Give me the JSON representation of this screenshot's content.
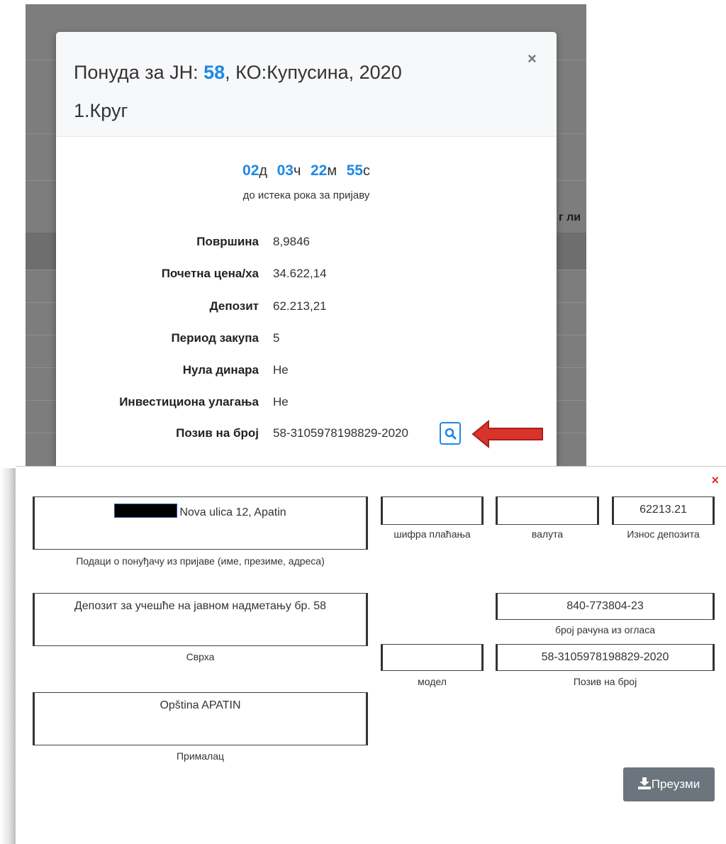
{
  "background": {
    "partial_text": "г ли"
  },
  "modal": {
    "title_prefix": "Понуда за ЈН: ",
    "title_number": "58",
    "title_suffix": ", КО:Купусина, 2020",
    "title_line2": "1.Круг",
    "close_symbol": "×",
    "countdown": {
      "days": "02",
      "days_unit": "д",
      "hours": "03",
      "hours_unit": "ч",
      "minutes": "22",
      "minutes_unit": "м",
      "seconds": "55",
      "seconds_unit": "с",
      "caption": "до истека рока за пријаву"
    },
    "fields": [
      {
        "label": "Површина",
        "value": "8,9846"
      },
      {
        "label": "Почетна цена/ха",
        "value": "34.622,14"
      },
      {
        "label": "Депозит",
        "value": "62.213,21"
      },
      {
        "label": "Период закупа",
        "value": "5"
      },
      {
        "label": "Нула динара",
        "value": "Не"
      },
      {
        "label": "Инвестициона улагања",
        "value": "Не"
      },
      {
        "label": "Позив на број",
        "value": "58-3105978198829-2020"
      }
    ],
    "search_icon": "search-icon",
    "accent_color": "#1e88e5",
    "arrow_color": "#d9342b"
  },
  "slip": {
    "close_symbol": "×",
    "payer_value": "Nova ulica 12, Apatin",
    "payer_label": "Подаци о понуђачу из пријаве (име, презиме, адреса)",
    "purpose_value": "Депозит за учешће на јавном надметању бр. 58",
    "purpose_label": "Сврха",
    "recipient_value": "Opština APATIN",
    "recipient_label": "Прималац",
    "payment_code_value": "",
    "payment_code_label": "шифра плаћања",
    "currency_value": "",
    "currency_label": "валута",
    "amount_value": "62213.21",
    "amount_label": "Износ депозита",
    "account_value": "840-773804-23",
    "account_label": "број рачуна из огласа",
    "model_value": "",
    "model_label": "модел",
    "reference_value": "58-3105978198829-2020",
    "reference_label": "Позив на број",
    "download_label": "Преузми",
    "download_icon": "download-icon"
  }
}
